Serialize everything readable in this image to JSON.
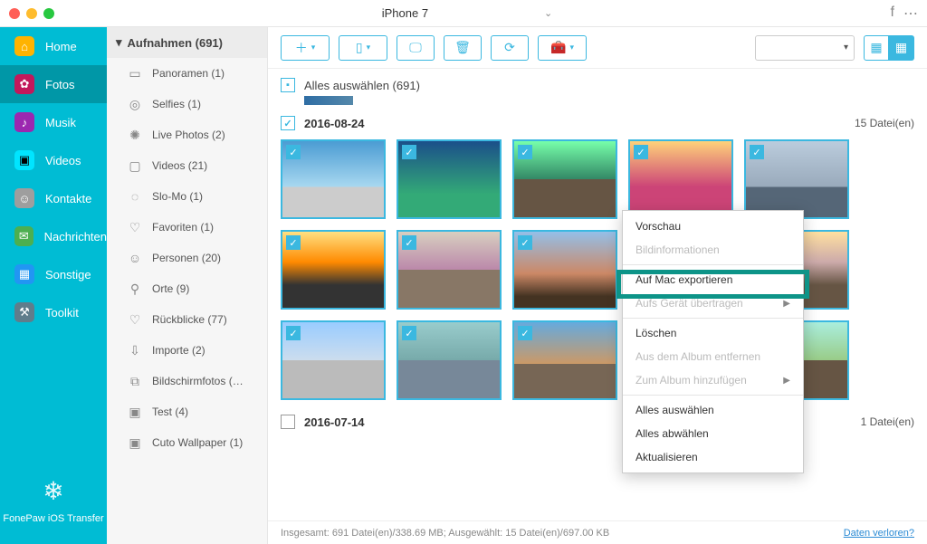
{
  "titlebar": {
    "device": "iPhone 7"
  },
  "navLeft": [
    {
      "label": "Home"
    },
    {
      "label": "Fotos"
    },
    {
      "label": "Musik"
    },
    {
      "label": "Videos"
    },
    {
      "label": "Kontakte"
    },
    {
      "label": "Nachrichten"
    },
    {
      "label": "Sonstige"
    },
    {
      "label": "Toolkit"
    }
  ],
  "brand": "FonePaw iOS Transfer",
  "midHeader": "Aufnahmen (691)",
  "midItems": [
    "Panoramen (1)",
    "Selfies (1)",
    "Live Photos (2)",
    "Videos (21)",
    "Slo-Mo (1)",
    "Favoriten (1)",
    "Personen (20)",
    "Orte (9)",
    "Rückblicke (77)",
    "Importe (2)",
    "Bildschirmfotos (…",
    "Test (4)",
    "Cuto Wallpaper (1)"
  ],
  "selectAll": "Alles auswählen (691)",
  "groups": [
    {
      "date": "2016-08-24",
      "count": "15 Datei(en)"
    },
    {
      "date": "2016-07-14",
      "count": "1 Datei(en)"
    }
  ],
  "footer": {
    "summary": "Insgesamt: 691 Datei(en)/338.69 MB; Ausgewählt: 15 Datei(en)/697.00 KB",
    "link": "Daten verloren?"
  },
  "ctx": {
    "preview": "Vorschau",
    "info": "Bildinformationen",
    "exportMac": "Auf Mac exportieren",
    "transfer": "Aufs Gerät übertragen",
    "delete": "Löschen",
    "removeAlbum": "Aus dem Album entfernen",
    "addAlbum": "Zum Album hinzufügen",
    "selAll": "Alles auswählen",
    "deselAll": "Alles abwählen",
    "refresh": "Aktualisieren"
  }
}
